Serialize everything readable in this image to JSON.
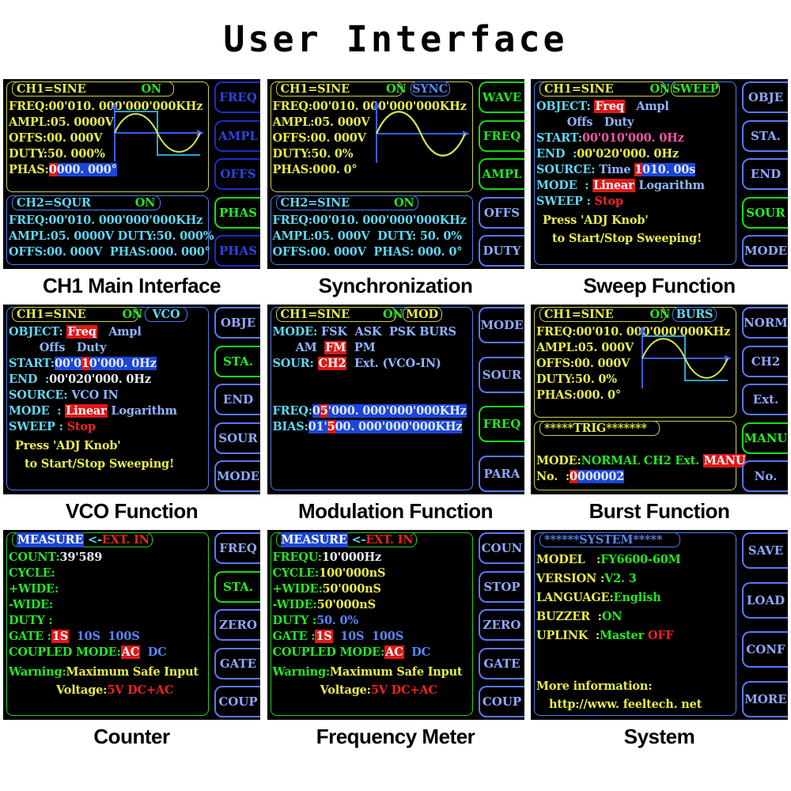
{
  "page_title": "User Interface",
  "panels": [
    {
      "id": "ch1-main",
      "caption": "CH1 Main Interface",
      "header": {
        "left": "CH1=SINE",
        "state": "ON"
      },
      "ch1": {
        "freq_label": "FREQ:",
        "freq_value": "00'010. 000'000'000KHz",
        "ampl_label": "AMPL:",
        "ampl_value": "05. 0000V",
        "offs_label": "OFFS:",
        "offs_value": "00. 000V",
        "duty_label": "DUTY:",
        "duty_value": "50. 000%",
        "phas_label": "PHAS:",
        "phas_value": "000. 000°",
        "phas_cursor": "0"
      },
      "ch2": {
        "header_left": "CH2=SQUR",
        "header_state": "ON",
        "freq": "FREQ:00'010. 000'000'000KHz",
        "line2": "AMPL:05. 0000V DUTY:50. 000%",
        "line3": "OFFS:00. 000V  PHAS:000. 000°"
      },
      "buttons": [
        {
          "label": "FREQ",
          "state": "idle"
        },
        {
          "label": "AMPL",
          "state": "idle"
        },
        {
          "label": "OFFS",
          "state": "idle"
        },
        {
          "label": "PHAS",
          "state": "active"
        },
        {
          "label": "PHAS",
          "state": "idle"
        }
      ]
    },
    {
      "id": "sync",
      "caption": "Synchronization",
      "header": {
        "left": "CH1=SINE",
        "state": "ON",
        "badge": "SYNC"
      },
      "ch1": {
        "freq": "FREQ:00'010. 000'000'000KHz",
        "ampl": "AMPL:05. 000V",
        "offs": "OFFS:00. 000V",
        "duty": "DUTY:50. 0%",
        "phas": "PHAS:000. 0°"
      },
      "ch2": {
        "header_left": "CH2=SINE",
        "header_state": "ON",
        "freq": "FREQ:00'010. 000'000'000KHz",
        "line2": "AMPL:05. 000V  DUTY: 50. 0%",
        "line3": "OFFS:00. 000V  PHAS: 000. 0°"
      },
      "buttons": [
        {
          "label": "WAVE",
          "state": "active"
        },
        {
          "label": "FREQ",
          "state": "active"
        },
        {
          "label": "AMPL",
          "state": "active"
        },
        {
          "label": "OFFS",
          "state": "lite"
        },
        {
          "label": "DUTY",
          "state": "lite"
        }
      ]
    },
    {
      "id": "sweep",
      "caption": "Sweep Function",
      "header": {
        "left": "CH1=SINE",
        "state": "ON",
        "badge": "SWEEP"
      },
      "rows": {
        "object_label": "OBJECT:",
        "object_opt1": "Freq",
        "object_opt2": "Ampl",
        "object_opt3": "Offs",
        "object_opt4": "Duty",
        "start_label": "START:",
        "start_value": "00'010'000. 0Hz",
        "end_label": "END  :",
        "end_value": "00'020'000. 0Hz",
        "source_label": "SOURCE:",
        "source_mode": "Time",
        "source_value": "010. 00s",
        "source_cursor": "1",
        "mode_label": "MODE  :",
        "mode_opt1": "Linear",
        "mode_opt2": "Logarithm",
        "sweep_label": "SWEEP :",
        "sweep_value": "Stop",
        "hint1": "Press 'ADJ Knob'",
        "hint2": "to Start/Stop Sweeping!"
      },
      "buttons": [
        {
          "label": "OBJE",
          "state": "idle"
        },
        {
          "label": "STA.",
          "state": "idle"
        },
        {
          "label": "END",
          "state": "idle"
        },
        {
          "label": "SOUR",
          "state": "active"
        },
        {
          "label": "MODE",
          "state": "idle"
        }
      ]
    },
    {
      "id": "vco",
      "caption": "VCO Function",
      "header": {
        "left": "CH1=SINE",
        "state": "ON",
        "badge": "VCO"
      },
      "rows": {
        "object_label": "OBJECT:",
        "object_opt1": "Freq",
        "object_opt2": "Ampl",
        "object_opt3": "Offs",
        "object_opt4": "Duty",
        "start_label": "START:",
        "start_value": "00'010'000. 0Hz",
        "start_cursor": "1",
        "end_label": "END  :",
        "end_value": "00'020'000. 0Hz",
        "source_label": "SOURCE:",
        "source_value": "VCO IN",
        "mode_label": "MODE  :",
        "mode_opt1": "Linear",
        "mode_opt2": "Logarithm",
        "sweep_label": "SWEEP :",
        "sweep_value": "Stop",
        "hint1": "Press 'ADJ Knob'",
        "hint2": "to Start/Stop Sweeping!"
      },
      "buttons": [
        {
          "label": "OBJE",
          "state": "idle"
        },
        {
          "label": "STA.",
          "state": "active"
        },
        {
          "label": "END",
          "state": "idle"
        },
        {
          "label": "SOUR",
          "state": "idle"
        },
        {
          "label": "MODE",
          "state": "idle"
        }
      ]
    },
    {
      "id": "modulation",
      "caption": "Modulation Function",
      "header": {
        "left": "CH1=SINE",
        "state": "ON",
        "badge": "MOD"
      },
      "rows": {
        "mode_label": "MODE:",
        "mode_opt1": "FSK",
        "mode_opt2": "ASK",
        "mode_opt3": "PSK",
        "mode_opt4": "BURS",
        "mode_opt5": "AM",
        "mode_opt6": "FM",
        "mode_opt7": "PM",
        "sour_label": "SOUR:",
        "sour_opt1": "CH2",
        "sour_opt2": "Ext. (VCO-IN)",
        "freq_label": "FREQ:",
        "freq_value": "05'000. 000'000'000KHz",
        "freq_cursor": "5",
        "bias_label": "BIAS:",
        "bias_value": "01'500. 000'000'000KHz",
        "bias_cursor": "5"
      },
      "buttons": [
        {
          "label": "MODE",
          "state": "idle"
        },
        {
          "label": "SOUR",
          "state": "idle"
        },
        {
          "label": "FREQ",
          "state": "active"
        },
        {
          "label": "PARA",
          "state": "idle"
        }
      ]
    },
    {
      "id": "burst",
      "caption": "Burst Function",
      "header": {
        "left": "CH1=SINE",
        "state": "ON",
        "badge": "BURS"
      },
      "ch1": {
        "freq": "FREQ:00'010. 000'000'000KHz",
        "ampl": "AMPL:05. 000V",
        "offs": "OFFS:00. 000V",
        "duty": "DUTY:50. 0%",
        "phas": "PHAS:000. 0°"
      },
      "trig": {
        "title": "*****TRIG*******",
        "mode_label": "MODE:",
        "mode_v1": "NORMAL",
        "mode_v2": "CH2",
        "mode_v3": "Ext.",
        "mode_v4": "MANU",
        "no_label": "No.  :",
        "no_value": "0000002",
        "no_cursor": "0"
      },
      "buttons": [
        {
          "label": "NORM",
          "state": "idle"
        },
        {
          "label": "CH2",
          "state": "idle"
        },
        {
          "label": "Ext.",
          "state": "idle"
        },
        {
          "label": "MANU",
          "state": "active"
        },
        {
          "label": "No.",
          "state": "idle"
        }
      ]
    },
    {
      "id": "counter",
      "caption": "Counter",
      "header": {
        "title": "MEASURE",
        "arrow": "<-",
        "source": "EXT. IN"
      },
      "rows": {
        "count_label": "COUNT:",
        "count_value": "39'589",
        "cycle_label": "CYCLE:",
        "cycle_value": "",
        "pwide_label": "+WIDE:",
        "pwide_value": "",
        "nwide_label": "-WIDE:",
        "nwide_value": "",
        "duty_label": "DUTY :",
        "duty_value": "",
        "gate_label": "GATE :",
        "gate_opt1": "1S",
        "gate_opt2": "10S",
        "gate_opt3": "100S",
        "coupled_label": "COUPLED MODE:",
        "coupled_opt1": "AC",
        "coupled_opt2": "DC",
        "warn1a": "Warning:",
        "warn1b": "Maximum Safe Input",
        "warn2a": "Voltage:",
        "warn2b": "5V DC+AC"
      },
      "buttons": [
        {
          "label": "FREQ",
          "state": "idle"
        },
        {
          "label": "STA.",
          "state": "active"
        },
        {
          "label": "ZERO",
          "state": "idle"
        },
        {
          "label": "GATE",
          "state": "idle"
        },
        {
          "label": "COUP",
          "state": "idle"
        }
      ]
    },
    {
      "id": "freq-meter",
      "caption": "Frequency Meter",
      "header": {
        "title": "MEASURE",
        "arrow": "<-",
        "source": "EXT. IN"
      },
      "rows": {
        "frequ_label": "FREQU:",
        "frequ_value": "10'000Hz",
        "cycle_label": "CYCLE:",
        "cycle_value": "100'000nS",
        "pwide_label": "+WIDE:",
        "pwide_value": "50'000nS",
        "nwide_label": "-WIDE:",
        "nwide_value": "50'000nS",
        "duty_label": "DUTY :",
        "duty_value": "50. 0%",
        "gate_label": "GATE :",
        "gate_opt1": "1S",
        "gate_opt2": "10S",
        "gate_opt3": "100S",
        "coupled_label": "COUPLED MODE:",
        "coupled_opt1": "AC",
        "coupled_opt2": "DC",
        "warn1a": "Warning:",
        "warn1b": "Maximum Safe Input",
        "warn2a": "Voltage:",
        "warn2b": "5V DC+AC"
      },
      "buttons": [
        {
          "label": "COUN",
          "state": "idle"
        },
        {
          "label": "STOP",
          "state": "idle"
        },
        {
          "label": "ZERO",
          "state": "idle"
        },
        {
          "label": "GATE",
          "state": "idle"
        },
        {
          "label": "COUP",
          "state": "idle"
        }
      ]
    },
    {
      "id": "system",
      "caption": "System",
      "header": {
        "title": "******SYSTEM*****"
      },
      "rows": {
        "model_label": "MODEL   :",
        "model_value": "FY6600-60M",
        "version_label": "VERSION :",
        "version_value": "V2. 3",
        "language_label": "LANGUAGE:",
        "language_value": "English",
        "buzzer_label": "BUZZER  :",
        "buzzer_value": "ON",
        "uplink_label": "UPLINK  :",
        "uplink_value": "Master",
        "uplink_state": "OFF",
        "more_label": "More information:",
        "url": "http://www. feeltech. net"
      },
      "buttons": [
        {
          "label": "SAVE",
          "state": "idle"
        },
        {
          "label": "LOAD",
          "state": "idle"
        },
        {
          "label": "CONF",
          "state": "idle"
        },
        {
          "label": "MORE",
          "state": "idle"
        }
      ]
    }
  ],
  "colors": {
    "yellow": "#e8ec4a",
    "green": "#22e822",
    "cyan": "#5fd8f5",
    "blue": "#5a86f5",
    "white": "#e9eef7",
    "red": "#ee2222",
    "highlight_red": "#e01818",
    "highlight_blue": "#1c46d8",
    "screen_bg": "#000000"
  }
}
